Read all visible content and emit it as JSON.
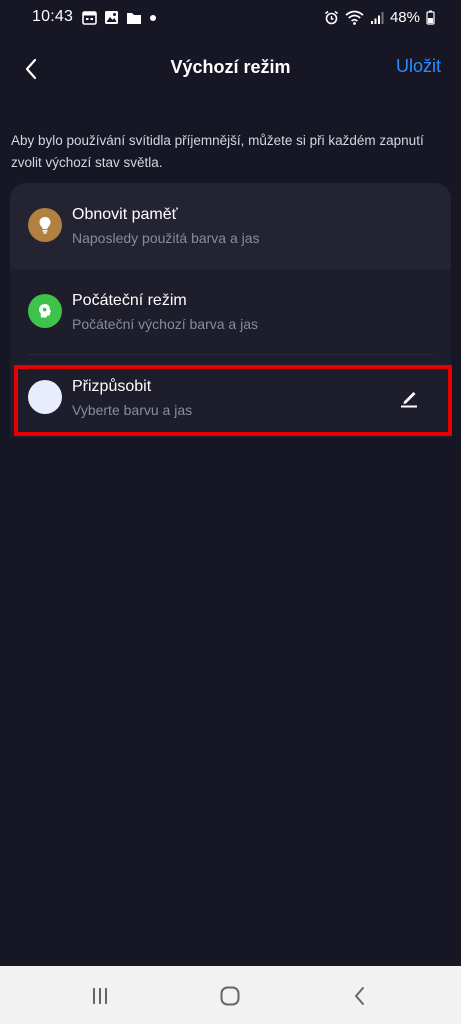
{
  "status_bar": {
    "time": "10:43",
    "battery": "48%",
    "left_icons": [
      "calendar-icon",
      "image-icon",
      "folder-icon",
      "dot-icon"
    ],
    "right_icons": [
      "alarm-icon",
      "wifi-icon",
      "signal-icon",
      "battery-icon"
    ]
  },
  "header": {
    "title": "Výchozí režim",
    "save_label": "Uložit"
  },
  "description": "Aby bylo používání svítidla příjemnější, můžete si při každém zapnutí zvolit výchozí stav světla.",
  "options": [
    {
      "title": "Obnovit paměť",
      "subtitle": "Naposledy použitá barva a jas",
      "icon": "lightbulb-icon",
      "icon_color": "#b0813f"
    },
    {
      "title": "Počáteční režim",
      "subtitle": "Počáteční výchozí barva a jas",
      "icon": "head-icon",
      "icon_color": "#3ec24a"
    },
    {
      "title": "Přizpůsobit",
      "subtitle": "Vyberte barvu a jas",
      "icon": "color-swatch-icon",
      "icon_color": "#e8ecff"
    }
  ],
  "colors": {
    "background": "#161624",
    "card": "#1d1d2b",
    "accent": "#2a8cff",
    "highlight": "#e80000"
  },
  "nav_bar": [
    "recent-apps-icon",
    "home-icon",
    "back-icon"
  ]
}
